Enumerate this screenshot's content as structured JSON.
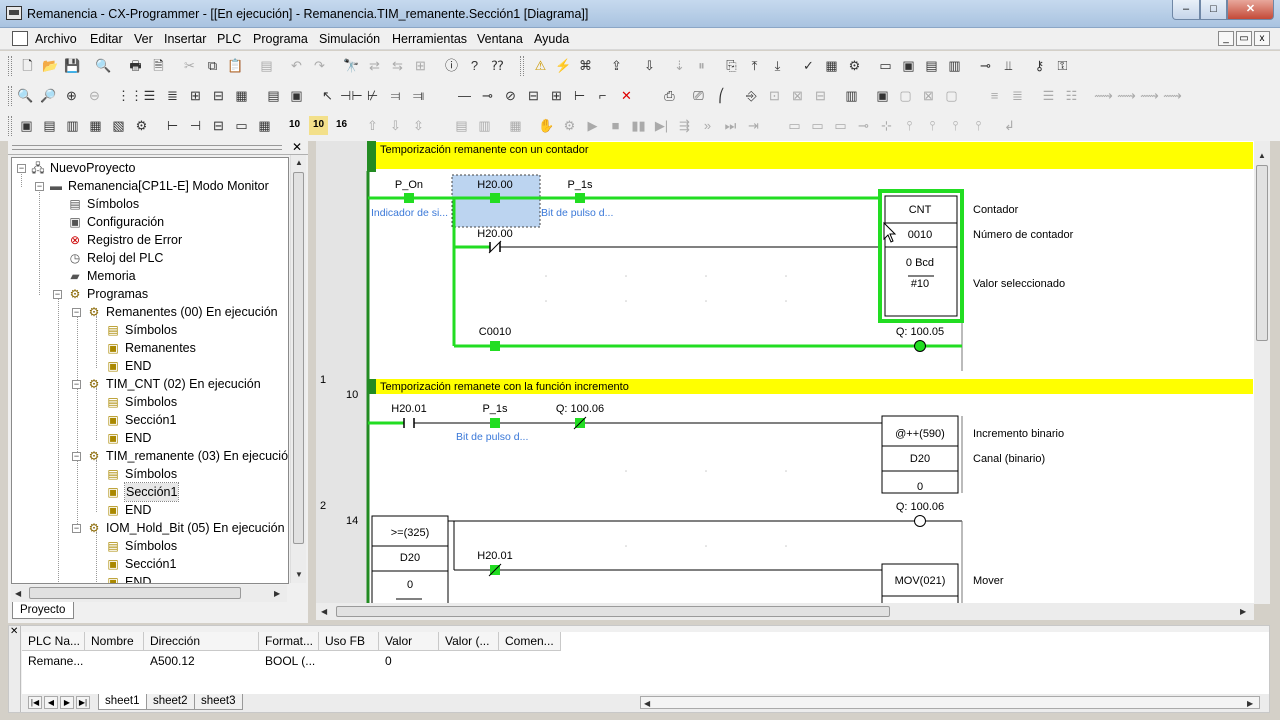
{
  "window": {
    "title": "Remanencia - CX-Programmer - [[En ejecución] - Remanencia.TIM_remanente.Sección1 [Diagrama]]",
    "min": "–",
    "max": "□",
    "close": "✕"
  },
  "menu": {
    "items": [
      "Archivo",
      "Editar",
      "Ver",
      "Insertar",
      "PLC",
      "Programa",
      "Simulación",
      "Herramientas",
      "Ventana",
      "Ayuda"
    ],
    "mdi_min": "_",
    "mdi_restore": "▭",
    "mdi_close": "x"
  },
  "toolbars": {
    "row1": [
      "new-file-icon",
      "open-folder-icon",
      "save-icon",
      "preview-icon",
      "print-icon",
      "print-preview-icon",
      "cut-icon",
      "copy-icon",
      "paste-icon",
      "paste-special-icon",
      "undo-icon",
      "redo-icon",
      "find-icon",
      "replace-icon",
      "replace-all-icon",
      "info-icon",
      "help-icon",
      "context-help-icon",
      "warning-icon",
      "online-icon",
      "monitor-icon",
      "transfer-icon",
      "run-icon",
      "pause-icon",
      "compare-icon",
      "upload-icon",
      "download-icon",
      "program-check-icon",
      "memory-icon",
      "io-table-icon",
      "settings-icon",
      "force-icon",
      "set-icon",
      "reset-icon",
      "diff-icon",
      "zoom-in-icon",
      "zoom-out-icon"
    ],
    "row2_numbers": [
      "10",
      "10",
      "16"
    ]
  },
  "project": {
    "tab": "Proyecto",
    "tree": [
      {
        "label": "NuevoProyecto",
        "icon": "network-icon"
      },
      {
        "label": "Remanencia[CP1L-E] Modo Monitor",
        "icon": "plc-icon"
      },
      {
        "label": "Símbolos",
        "icon": "symbols-icon"
      },
      {
        "label": "Configuración",
        "icon": "config-icon"
      },
      {
        "label": "Registro de Error",
        "icon": "error-log-icon"
      },
      {
        "label": "Reloj del PLC",
        "icon": "clock-icon"
      },
      {
        "label": "Memoria",
        "icon": "memory-icon"
      },
      {
        "label": "Programas",
        "icon": "programs-icon"
      },
      {
        "label": "Remanentes (00) En ejecución",
        "icon": "task-icon"
      },
      {
        "label": "Símbolos",
        "icon": "symbols-icon"
      },
      {
        "label": "Remanentes",
        "icon": "section-icon"
      },
      {
        "label": "END",
        "icon": "section-icon"
      },
      {
        "label": "TIM_CNT (02) En ejecución",
        "icon": "task-icon"
      },
      {
        "label": "Símbolos",
        "icon": "symbols-icon"
      },
      {
        "label": "Sección1",
        "icon": "section-icon"
      },
      {
        "label": "END",
        "icon": "section-icon"
      },
      {
        "label": "TIM_remanente (03) En ejecución",
        "icon": "task-icon"
      },
      {
        "label": "Símbolos",
        "icon": "symbols-icon"
      },
      {
        "label": "Sección1",
        "icon": "section-icon"
      },
      {
        "label": "END",
        "icon": "section-icon"
      },
      {
        "label": "IOM_Hold_Bit (05) En ejecución",
        "icon": "task-icon"
      },
      {
        "label": "Símbolos",
        "icon": "symbols-icon"
      },
      {
        "label": "Sección1",
        "icon": "section-icon"
      },
      {
        "label": "END",
        "icon": "section-icon"
      }
    ]
  },
  "ladder": {
    "rung0": {
      "comment": "Temporización remanente con un contador",
      "contacts": [
        {
          "addr": "P_On",
          "comment": "Indicador de si..."
        },
        {
          "addr": "H20.00",
          "comment": ""
        },
        {
          "addr": "P_1s",
          "comment": "Bit de pulso d..."
        }
      ],
      "reset_contact": "H20.00",
      "counter": {
        "name": "CNT",
        "number": "0010",
        "value_label": "0 Bcd",
        "preset": "#10"
      },
      "operands": [
        "Contador",
        "Número de contador",
        "Valor seleccionado"
      ],
      "coil_contact": "C0010",
      "coil": "Q: 100.05"
    },
    "rung1": {
      "index": "1",
      "step": "10",
      "comment": "Temporización remanete con la función incremento",
      "contacts": [
        {
          "addr": "H20.01",
          "comment": ""
        },
        {
          "addr": "P_1s",
          "comment": "Bit de pulso d..."
        },
        {
          "addr": "Q: 100.06",
          "comment": ""
        }
      ],
      "block": {
        "name": "@++(590)",
        "operand": "D20",
        "value": "0"
      },
      "operands": [
        "Incremento binario",
        "Canal (binario)"
      ]
    },
    "rung2": {
      "index": "2",
      "step": "14",
      "compare": {
        "name": ">=(325)",
        "operand": "D20",
        "value": "0"
      },
      "coil": "Q: 100.06",
      "contact": "H20.01",
      "block": {
        "name": "MOV(021)"
      },
      "operands": [
        "Mover"
      ]
    }
  },
  "watch": {
    "columns": [
      "PLC Na...",
      "Nombre",
      "Dirección",
      "Format...",
      "Uso FB",
      "Valor",
      "Valor (...",
      "Comen..."
    ],
    "rows": [
      [
        "Remane...",
        "",
        "A500.12",
        "BOOL (...",
        "",
        "0",
        "",
        ""
      ]
    ],
    "sheets": [
      "sheet1",
      "sheet2",
      "sheet3"
    ]
  },
  "colors": {
    "power_active": "#22dd22",
    "comment_bar": "#ffff00",
    "rung_marker": "#228b22",
    "selection": "#bcd4f0"
  }
}
